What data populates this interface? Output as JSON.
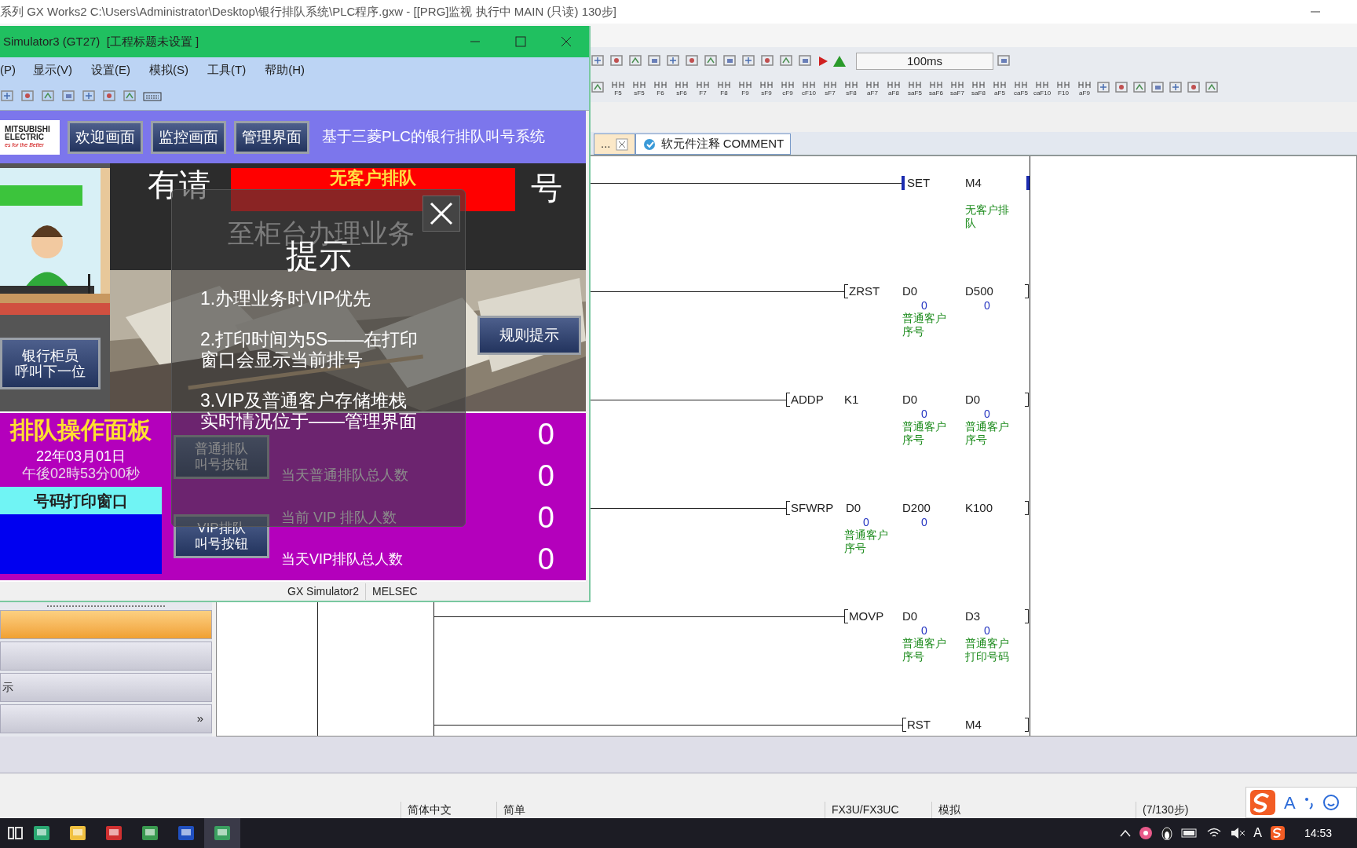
{
  "main_window": {
    "title": "系列 GX Works2 C:\\Users\\Administrator\\Desktop\\银行排队系统\\PLC程序.gxw - [[PRG]监视 执行中 MAIN (只读) 130步]"
  },
  "toolbar": {
    "scan_time": "100ms",
    "function_keys": [
      "F5",
      "sF5",
      "F6",
      "sF6",
      "F7",
      "F8",
      "F9",
      "sF9",
      "cF9",
      "cF10",
      "sF7",
      "sF8",
      "aF7",
      "aF8",
      "saF5",
      "saF6",
      "saF7",
      "saF8",
      "aF5",
      "caF5",
      "caF10",
      "F10",
      "aF9"
    ]
  },
  "editor_tabs": [
    {
      "label": "...",
      "selected": false
    },
    {
      "label": "软元件注释 COMMENT",
      "selected": true
    }
  ],
  "ladder": {
    "rungs": [
      {
        "instruction": "SET",
        "monitored": true,
        "operands": [
          {
            "device": "M4",
            "comment": "无客户排队"
          }
        ]
      },
      {
        "instruction": "ZRST",
        "monitored": false,
        "operands": [
          {
            "device": "D0",
            "value": "0",
            "comment": "普通客户序号"
          },
          {
            "device": "D500",
            "value": "0"
          }
        ]
      },
      {
        "instruction": "ADDP",
        "monitored": false,
        "operands": [
          {
            "device": "K1"
          },
          {
            "device": "D0",
            "value": "0",
            "comment": "普通客户序号"
          },
          {
            "device": "D0",
            "value": "0",
            "comment": "普通客户序号"
          }
        ]
      },
      {
        "instruction": "SFWRP",
        "monitored": false,
        "operands": [
          {
            "device": "D0",
            "value": "0",
            "comment": "普通客户序号"
          },
          {
            "device": "D200",
            "value": "0"
          },
          {
            "device": "K100"
          }
        ]
      },
      {
        "instruction": "MOVP",
        "monitored": false,
        "operands": [
          {
            "device": "D0",
            "value": "0",
            "comment": "普通客户序号"
          },
          {
            "device": "D3",
            "value": "0",
            "comment": "普通客户打印号码"
          }
        ]
      },
      {
        "instruction": "RST",
        "monitored": false,
        "operands": [
          {
            "device": "M4"
          }
        ]
      }
    ]
  },
  "navigation": {
    "items": [
      {
        "selected": true
      },
      {
        "selected": false
      },
      {
        "label": "示",
        "selected": false
      }
    ],
    "expand_button": "»"
  },
  "status_bar": [
    "简体中文",
    "简单",
    "FX3U/FX3UC",
    "模拟",
    "(7/130步)"
  ],
  "ime_bar": {
    "mode": "A"
  },
  "taskbar": {
    "tray_input": "A",
    "clock": "14:53"
  },
  "simulator": {
    "title": "Simulator3 (GT27)  [工程标题未设置 ]",
    "menu": [
      "(P)",
      "显示(V)",
      "设置(E)",
      "模拟(S)",
      "工具(T)",
      "帮助(H)"
    ],
    "hmi": {
      "logo": [
        "MITSUBISHI",
        "ELECTRIC",
        "es for the Better"
      ],
      "nav_buttons": [
        "欢迎画面",
        "监控画面",
        "管理界面"
      ],
      "title": "基于三菱PLC的银行排队叫号系统",
      "call_prefix": "有请",
      "current_number": "无客户排队",
      "call_suffix": "号",
      "instruction": "至柜台办理业务",
      "call_next_button": [
        "银行柜员",
        "呼叫下一位"
      ],
      "rules_button": "规则提示",
      "panel_title": "排队操作面板",
      "date": "22年03月01日",
      "time": "午後02時53分00秒",
      "print_window_title": "号码打印窗口",
      "queue_buttons": [
        [
          "普通排队",
          "叫号按钮"
        ],
        [
          "VIP排队",
          "叫号按钮"
        ]
      ],
      "counters": [
        {
          "value": "0"
        },
        {
          "label": "当天普通排队总人数",
          "value": "0"
        },
        {
          "label": "当前 VIP 排队人数",
          "value": "0"
        },
        {
          "label": "当天VIP排队总人数",
          "value": "0"
        }
      ]
    },
    "dialog": {
      "title": "提示",
      "lines": [
        [
          "1.办理业务时VIP优先"
        ],
        [
          "2.打印时间为5S——在打印",
          "窗口会显示当前排号"
        ],
        [
          "3.VIP及普通客户存储堆栈",
          "实时情况位于——管理界面"
        ]
      ]
    },
    "status": [
      "GX Simulator2",
      "MELSEC"
    ]
  }
}
